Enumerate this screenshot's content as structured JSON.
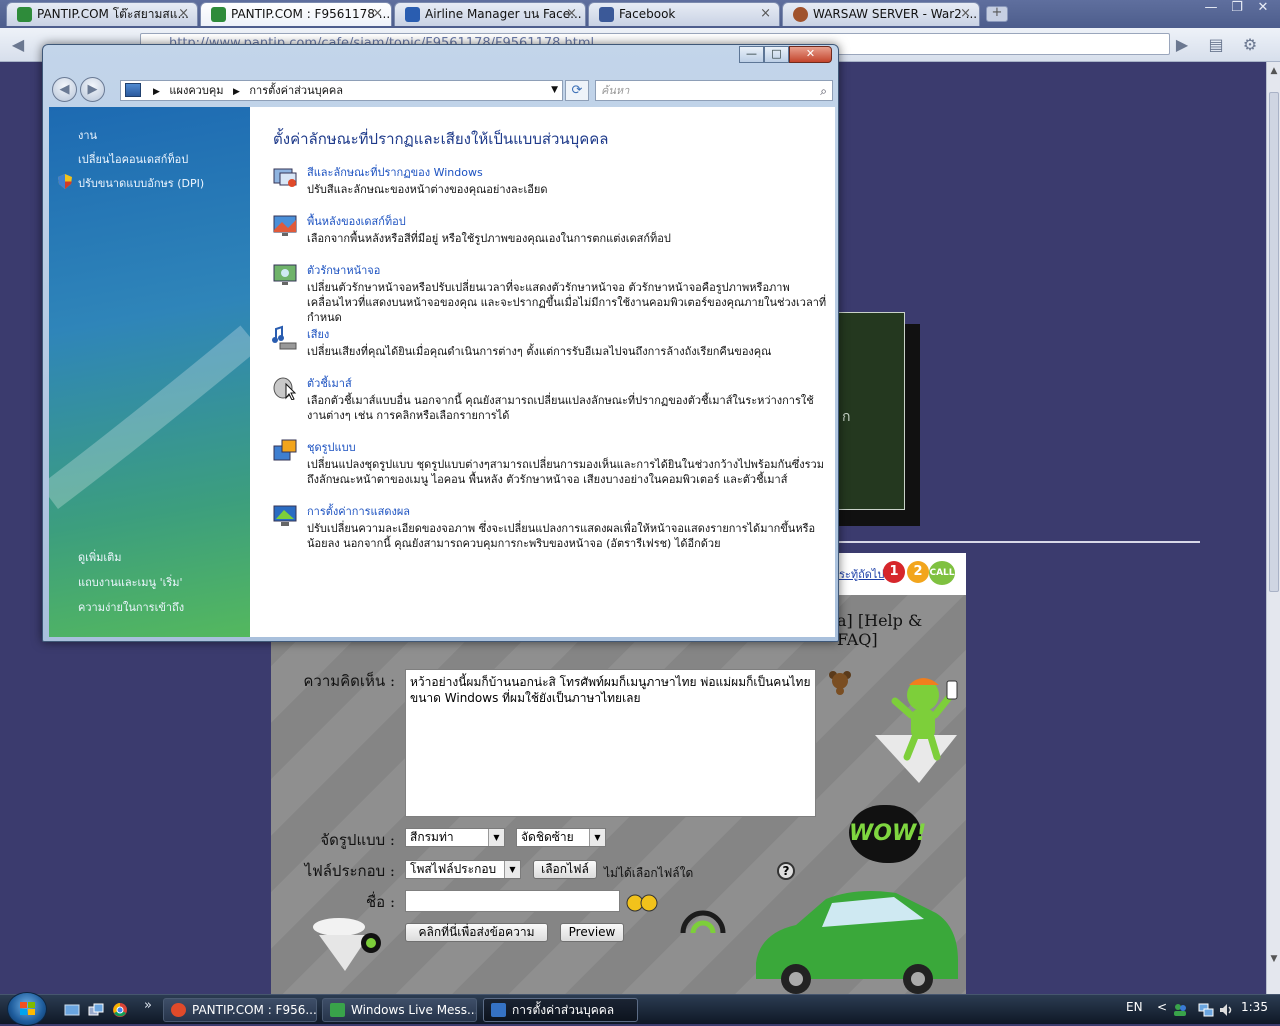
{
  "browser": {
    "tabs": [
      {
        "label": "PANTIP.COM โต๊ะสยามสแ...",
        "favicon_color": "#2e8b3a",
        "active": false
      },
      {
        "label": "PANTIP.COM : F9561178 ...",
        "favicon_color": "#2e8b3a",
        "active": true
      },
      {
        "label": "Airline Manager บน Face...",
        "favicon_color": "#2a5db0",
        "active": false
      },
      {
        "label": "Facebook",
        "favicon_color": "#3b5998",
        "active": false
      },
      {
        "label": "WARSAW SERVER - War2 ...",
        "favicon_color": "#a0522d",
        "active": false
      }
    ],
    "tab_close_glyph": "×",
    "new_tab_glyph": "+",
    "window_controls": {
      "minimize": "—",
      "maximize": "❐",
      "close": "✕"
    },
    "url": "http://www.pantip.com/cafe/siam/topic/F9561178/F9561178.html"
  },
  "webpage": {
    "dark_box_text": "ก",
    "next_link": "ระทู้ถัดไป",
    "logos": {
      "one": "1",
      "two": "2",
      "call": "CALL"
    },
    "help_link": "a] [Help & FAQ]",
    "form": {
      "comment_label": "ความคิดเห็น :",
      "comment_text": "หว้าอย่างนี้ผมก็บ้านนอกน่ะสิ โทรศัพท์ผมก็เมนูภาษาไทย พ่อแม่ผมก็เป็นคนไทย ขนาด Windows ที่ผมใช้ยังเป็นภาษาไทยเลย",
      "format_label": "จัดรูปแบบ :",
      "color_select": "สีกรมท่า",
      "align_select": "จัดชิดซ้าย",
      "attach_label": "ไฟล์ประกอบ :",
      "attach_select": "โพสไฟล์ประกอบ",
      "choose_file_button": "เลือกไฟล์",
      "no_file_text": "ไม่ได้เลือกไฟล์ใด",
      "name_label": "ชื่อ :",
      "name_value": "",
      "submit_button": "คลิกที่นี่เพื่อส่งข้อความ",
      "preview_button": "Preview"
    },
    "decor": {
      "wow": "WOW!",
      "question": "?"
    }
  },
  "control_panel": {
    "caption": {
      "minimize": "—",
      "maximize": "□",
      "close": "✕"
    },
    "nav": {
      "back": "◀",
      "forward": "▶"
    },
    "breadcrumb": [
      "แผงควบคุม",
      "การตั้งค่าส่วนบุคคล"
    ],
    "refresh_glyph": "⟳",
    "search_placeholder": "ค้นหา",
    "sidebar_tasks": [
      "งาน",
      "เปลี่ยนไอคอนเดสก์ท็อป",
      "ปรับขนาดแบบอักษร (DPI)"
    ],
    "sidebar_see_also": [
      "ดูเพิ่มเติม",
      "แถบงานและเมนู 'เริ่ม'",
      "ความง่ายในการเข้าถึง"
    ],
    "title": "ตั้งค่าลักษณะที่ปรากฏและเสียงให้เป็นแบบส่วนบุคคล",
    "items": [
      {
        "head": "สีและลักษณะที่ปรากฏของ Windows",
        "desc": "ปรับสีและลักษณะของหน้าต่างของคุณอย่างละเอียด"
      },
      {
        "head": "พื้นหลังของเดสก์ท็อป",
        "desc": "เลือกจากพื้นหลังหรือสีที่มีอยู่ หรือใช้รูปภาพของคุณเองในการตกแต่งเดสก์ท็อป"
      },
      {
        "head": "ตัวรักษาหน้าจอ",
        "desc": "เปลี่ยนตัวรักษาหน้าจอหรือปรับเปลี่ยนเวลาที่จะแสดงตัวรักษาหน้าจอ ตัวรักษาหน้าจอคือรูปภาพหรือภาพเคลื่อนไหวที่แสดงบนหน้าจอของคุณ และจะปรากฏขึ้นเมื่อไม่มีการใช้งานคอมพิวเตอร์ของคุณภายในช่วงเวลาที่กำหนด"
      },
      {
        "head": "เสียง",
        "desc": "เปลี่ยนเสียงที่คุณได้ยินเมื่อคุณดำเนินการต่างๆ ตั้งแต่การรับอีเมลไปจนถึงการล้างถังเรียกคืนของคุณ"
      },
      {
        "head": "ตัวชี้เมาส์",
        "desc": "เลือกตัวชี้เมาส์แบบอื่น นอกจากนี้ คุณยังสามารถเปลี่ยนแปลงลักษณะที่ปรากฏของตัวชี้เมาส์ในระหว่างการใช้งานต่างๆ เช่น การคลิกหรือเลือกรายการได้"
      },
      {
        "head": "ชุดรูปแบบ",
        "desc": "เปลี่ยนแปลงชุดรูปแบบ ชุดรูปแบบต่างๆสามารถเปลี่ยนการมองเห็นและการได้ยินในช่วงกว้างไปพร้อมกันซึ่งรวมถึงลักษณะหน้าตาของเมนู ไอคอน พื้นหลัง ตัวรักษาหน้าจอ เสียงบางอย่างในคอมพิวเตอร์ และตัวชี้เมาส์"
      },
      {
        "head": "การตั้งค่าการแสดงผล",
        "desc": "ปรับเปลี่ยนความละเอียดของจอภาพ ซึ่งจะเปลี่ยนแปลงการแสดงผลเพื่อให้หน้าจอแสดงรายการได้มากขึ้นหรือน้อยลง นอกจากนี้ คุณยังสามารถควบคุมการกะพริบของหน้าจอ (อัตรารีเฟรช) ได้อีกด้วย"
      }
    ]
  },
  "taskbar": {
    "quicklaunch_more": "»",
    "buttons": [
      {
        "label": "PANTIP.COM : F956...",
        "icon_color": "#e04a2a",
        "active": false
      },
      {
        "label": "Windows Live Mess...",
        "icon_color": "#39a34a",
        "active": false
      },
      {
        "label": "การตั้งค่าส่วนบุคคล",
        "icon_color": "#3572c4",
        "active": true
      }
    ],
    "lang": "EN",
    "tray_chevron": "<",
    "time": "1:35"
  }
}
